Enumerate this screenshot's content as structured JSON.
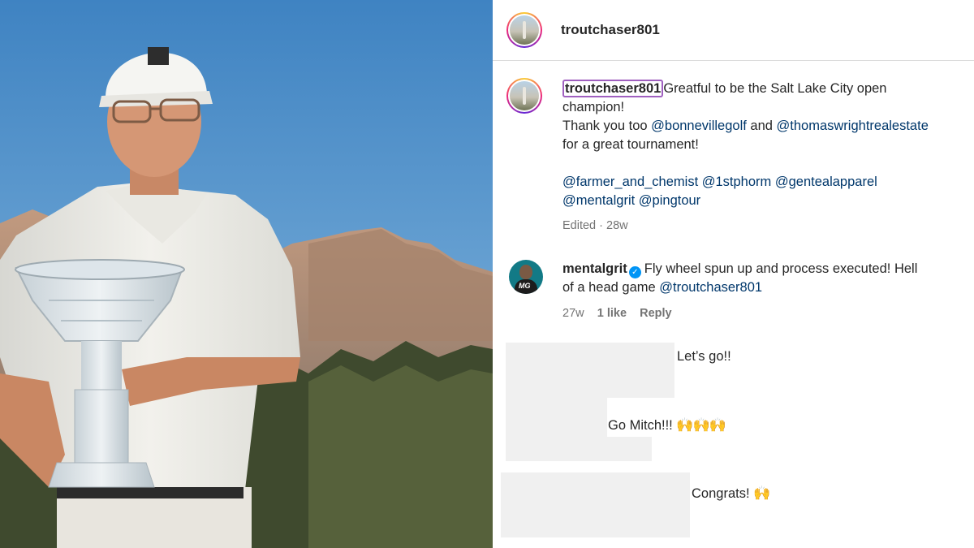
{
  "post": {
    "username": "troutchaser801",
    "caption_lines": [
      "Greatful to be the Salt Lake City open",
      "champion!"
    ],
    "thanks": {
      "prefix": "Thank you too ",
      "mention1": "@bonnevillegolf",
      "middle": " and ",
      "mention2": "@thomaswrightrealestate",
      "suffix": "for a great tournament!"
    },
    "tags": [
      "@farmer_and_chemist",
      "@1stphorm",
      "@gentealapparel",
      "@mentalgrit",
      "@pingtour"
    ],
    "edited": "Edited",
    "age": "28w"
  },
  "comments": [
    {
      "username": "mentalgrit",
      "verified": true,
      "text": "Fly wheel spun up and process executed! Hell",
      "text2": "of a head game ",
      "mention": "@troutchaser801",
      "age": "27w",
      "likes": "1 like",
      "reply": "Reply"
    }
  ],
  "replies": [
    {
      "text": "Let’s go!!",
      "emoji": ""
    },
    {
      "text": "Go Mitch!!! ",
      "emoji": "🙌🙌🙌"
    },
    {
      "text": "Congrats! ",
      "emoji": "🙌"
    }
  ],
  "icons": {
    "verified": "✓",
    "avatar_logo": "MG"
  },
  "colors": {
    "link": "#00376b",
    "verified": "#0095f6",
    "secondary_text": "#737373",
    "sky": "#4f8ec5"
  }
}
